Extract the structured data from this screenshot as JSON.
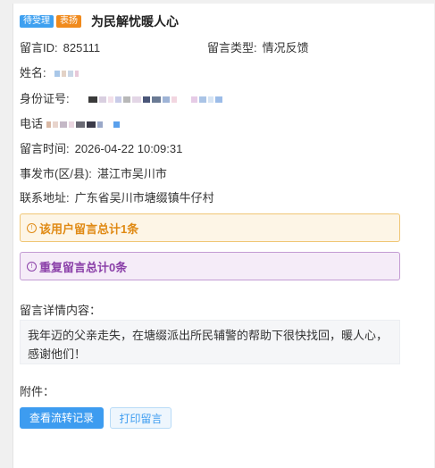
{
  "header": {
    "status_badge": "待受理",
    "type_badge": "表扬",
    "title": "为民解忧暖人心"
  },
  "fields": {
    "message_id_label": "留言ID:",
    "message_id": "825111",
    "message_type_label": "留言类型:",
    "message_type": "情况反馈",
    "name_label": "姓名:",
    "id_card_label": "身份证号:",
    "phone_label": "电话",
    "time_label": "留言时间:",
    "time": "2026-04-22 10:09:31",
    "city_label": "事发市(区/县):",
    "city": "湛江市吴川市",
    "address_label": "联系地址:",
    "address": "广东省吴川市塘缀镇牛仔村"
  },
  "alerts": {
    "user_total": "该用户留言总计1条",
    "duplicate_total": "重复留言总计0条"
  },
  "detail": {
    "label": "留言详情内容：",
    "text": "我年迈的父亲走失，在塘缀派出所民辅警的帮助下很快找回，暖人心，感谢他们！"
  },
  "attachment_label": "附件：",
  "buttons": {
    "view_flow": "查看流转记录",
    "print": "打印留言"
  },
  "colors": {
    "primary": "#3d9cf0",
    "status_badge": "#3ea0f0",
    "type_badge": "#f08a1c",
    "warning": "#e08a14",
    "purple": "#8a3fa8"
  }
}
